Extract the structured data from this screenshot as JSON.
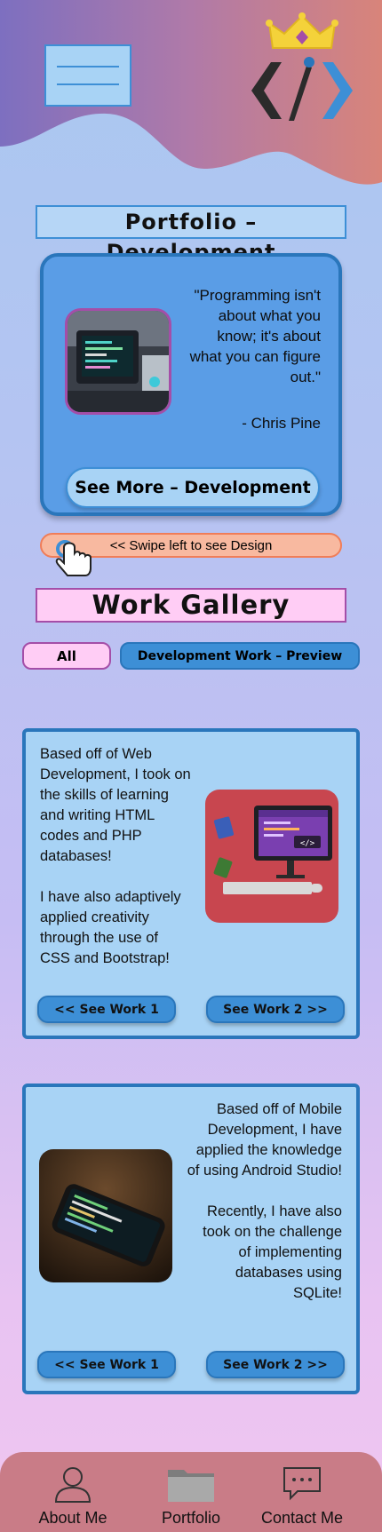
{
  "colors": {
    "accent_blue": "#3d8fd6",
    "dark_blue": "#2a76bb",
    "light_blue": "#a8d3f5",
    "pink": "#ffcdf5",
    "purple": "#a44ea8",
    "salmon": "#f8b9a0",
    "nav_background": "#c97c87"
  },
  "header": {
    "menu_icon": "hamburger-menu-icon",
    "logo_icon": "crown-code-brush-logo"
  },
  "portfolio": {
    "title": "Portfolio – Development",
    "quote": "\"Programming isn't about what you know; it's about what you can figure out.\"",
    "author": "- Chris Pine",
    "see_more_label": "See More – Development",
    "swipe_hint": "<< Swipe left to see Design"
  },
  "gallery": {
    "title": "Work Gallery",
    "filters": {
      "all": "All",
      "development": "Development Work – Preview"
    },
    "cards": [
      {
        "text": "Based off of Web Development, I took on the skills of learning and writing HTML codes and PHP databases!\n\nI have also adaptively applied creativity through the use of CSS and Bootstrap!",
        "image_icon": "computer-code-illustration",
        "btn_prev": "<< See Work 1",
        "btn_next": "See Work 2 >>"
      },
      {
        "text": "Based off of Mobile Development, I have applied the knowledge of using Android Studio!\n\nRecently, I have also took on the challenge of implementing databases using SQLite!",
        "image_icon": "smartphone-photo",
        "btn_prev": "<< See Work 1",
        "btn_next": "See Work 2 >>"
      }
    ]
  },
  "nav": {
    "items": [
      {
        "label": "About Me",
        "icon": "person-icon"
      },
      {
        "label": "Portfolio",
        "icon": "folder-icon"
      },
      {
        "label": "Contact Me",
        "icon": "chat-icon"
      }
    ]
  }
}
